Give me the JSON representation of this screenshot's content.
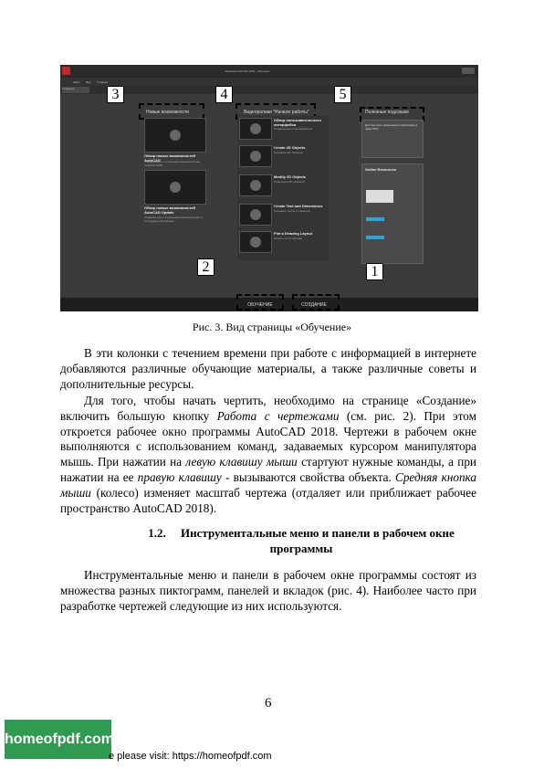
{
  "figure": {
    "titlebar_text": "Autodesk AutoCAD 2018 - Обучение",
    "menu_items": [
      "Файл",
      "Вид",
      "Справка"
    ],
    "tabs": [
      "Создание",
      "Обучение"
    ],
    "callouts": [
      "1",
      "2",
      "3",
      "4",
      "5"
    ],
    "col1_header": "Новые возможности",
    "col2_header": "Видеоролики \"Начало работы\"",
    "col3_header": "Полезные подсказки",
    "left_videos": [
      {
        "title": "Обзор новых возможностей AutoCAD",
        "desc": "Ознакомьтесь с основными возможностями AutoCAD 2018"
      },
      {
        "title": "Обзор новых возможностей AutoCAD Update",
        "desc": "Ознакомьтесь с основными возможностями в последнем обновлении"
      }
    ],
    "middle_videos": [
      {
        "title": "Обзор пользовательского интерфейса",
        "desc": "Ознакомьтесь с интерфейсом"
      },
      {
        "title": "Create 2D Objects",
        "desc": "Создание 2D объектов"
      },
      {
        "title": "Modify 2D Objects",
        "desc": "Изменение 2D объектов"
      },
      {
        "title": "Create Text and Dimensions",
        "desc": "Создание текста и размеров"
      },
      {
        "title": "Plot a Drawing Layout",
        "desc": "Печать листа чертежа"
      }
    ],
    "tip_text": "Для быстрого размещения примитивов в файл PDF",
    "online_header": "Online Resources",
    "bottom_buttons": [
      "ОБУЧЕНИЕ",
      "СОЗДАНИЕ"
    ]
  },
  "caption": "Рис. 3. Вид страницы «Обучение»",
  "p1": "В эти колонки с течением времени при работе с информацией в интернете добавляются различные обучающие материалы, а также различные советы и дополнительные ресурсы.",
  "p2": {
    "a": "Для того, чтобы начать чертить, необходимо на странице «Создание» включить большую кнопку ",
    "b": "Работа с чертежами",
    "c": " (см. рис. 2). При этом откроется рабочее окно программы AutoCAD 2018. Чертежи в рабочем окне выполняются с использованием команд, задаваемых курсором манипулятора мышь. При нажатии на ",
    "d": "левую клавишу мыши",
    "e": " стартуют нужные команды, а при нажатии на ее ",
    "f": "правую клавишу",
    "g": " - вызываются свойства объекта. ",
    "h": "Средняя кнопка мыши",
    "i": " (колесо) изменяет масштаб чертежа (отдаляет или приближает рабочее пространство AutoCAD 2018)."
  },
  "heading": {
    "number": "1.2.",
    "line1": "Инструментальные меню и панели в рабочем окне",
    "line2": "программы"
  },
  "p3": "Инструментальные меню и панели в рабочем окне программы состоят из множества разных пиктограмм, панелей и вкладок (рис. 4). Наиболее часто при разработке чертежей следующие из них используются.",
  "page_number": "6",
  "logo_text": "homeofpdf.com",
  "footer_text": "e please visit: https://homeofpdf.com"
}
